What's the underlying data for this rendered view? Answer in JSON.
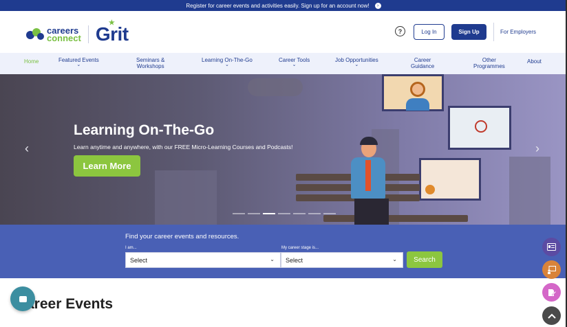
{
  "topbar": {
    "message": "Register for career events and activities easily. Sign up for an account now!",
    "arrow": "›"
  },
  "header": {
    "logo_line1": "careers",
    "logo_line2": "connect",
    "logo_grit": "Grit",
    "help_icon": "?",
    "login_label": "Log In",
    "signup_label": "Sign Up",
    "employers_label": "For Employers"
  },
  "nav": {
    "home": "Home",
    "featured": "Featured Events",
    "seminars1": "Seminars &",
    "seminars2": "Workshops",
    "learning": "Learning On-The-Go",
    "tools": "Career Tools",
    "jobs": "Job Opportunities",
    "guidance1": "Career",
    "guidance2": "Guidance",
    "other1": "Other",
    "other2": "Programmes",
    "about": "About",
    "chevron": "⌄"
  },
  "hero": {
    "title": "Learning On-The-Go",
    "subtitle": "Learn anytime and anywhere, with our FREE Micro-Learning Courses and Podcasts!",
    "cta": "Learn More",
    "prev": "‹",
    "next": "›",
    "active_slide": 3,
    "slide_count": 7
  },
  "search": {
    "title": "Find your career events and resources.",
    "label1": "I am...",
    "label2": "My career stage is...",
    "select1": "Select",
    "select2": "Select",
    "dropdown": "⌄",
    "button": "Search"
  },
  "section": {
    "title": "areer Events"
  },
  "colors": {
    "brand_blue": "#1f3b8f",
    "brand_green": "#8cc63f",
    "search_band": "#4960b5",
    "fab_purple": "#5b4ba3",
    "fab_orange": "#d9833a",
    "fab_pink": "#d467c8",
    "fab_grey": "#4a4a4a",
    "chat_teal": "#3c8ea0"
  },
  "icons": [
    "help-icon",
    "arrow-right-icon",
    "chevron-left-icon",
    "chevron-right-icon",
    "chat-icon",
    "id-card-icon",
    "presentation-icon",
    "edit-document-icon",
    "scroll-up-icon"
  ]
}
